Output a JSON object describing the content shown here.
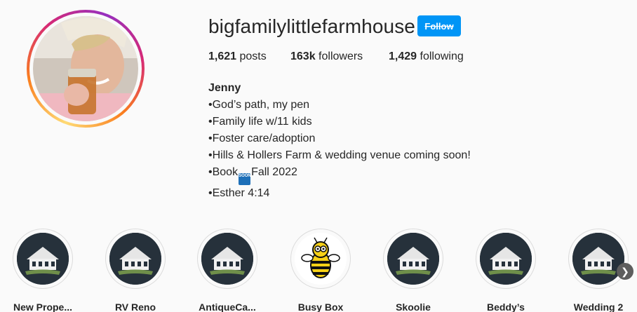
{
  "profile": {
    "username": "bigfamilylittlefarmhouse",
    "follow_label": "Follow",
    "stats": {
      "posts_count": "1,621",
      "posts_label": "posts",
      "followers_count": "163k",
      "followers_label": "followers",
      "following_count": "1,429",
      "following_label": "following"
    },
    "bio": {
      "name": "Jenny",
      "lines": [
        "•God’s path, my pen",
        "•Family life w/11 kids",
        "•Foster care/adoption",
        "•Hills & Hollers Farm & wedding venue coming soon!"
      ],
      "book_prefix": "•Book",
      "soon_badge": "SOON",
      "book_suffix": "Fall 2022",
      "last_line": "•Esther 4:14"
    }
  },
  "highlights": [
    {
      "label": "New Prope...",
      "icon": "farmhouse-icon"
    },
    {
      "label": "RV Reno",
      "icon": "farmhouse-icon"
    },
    {
      "label": "AntiqueCa...",
      "icon": "farmhouse-icon"
    },
    {
      "label": "Busy Box",
      "icon": "bee-icon"
    },
    {
      "label": "Skoolie",
      "icon": "farmhouse-icon"
    },
    {
      "label": "Beddy’s",
      "icon": "farmhouse-icon"
    },
    {
      "label": "Wedding 2",
      "icon": "farmhouse-icon"
    }
  ],
  "colors": {
    "follow_button": "#0095f6",
    "highlight_bg": "#26313b",
    "story_ring": [
      "#feda75",
      "#fa7e1e",
      "#d62976",
      "#962fbf"
    ]
  }
}
